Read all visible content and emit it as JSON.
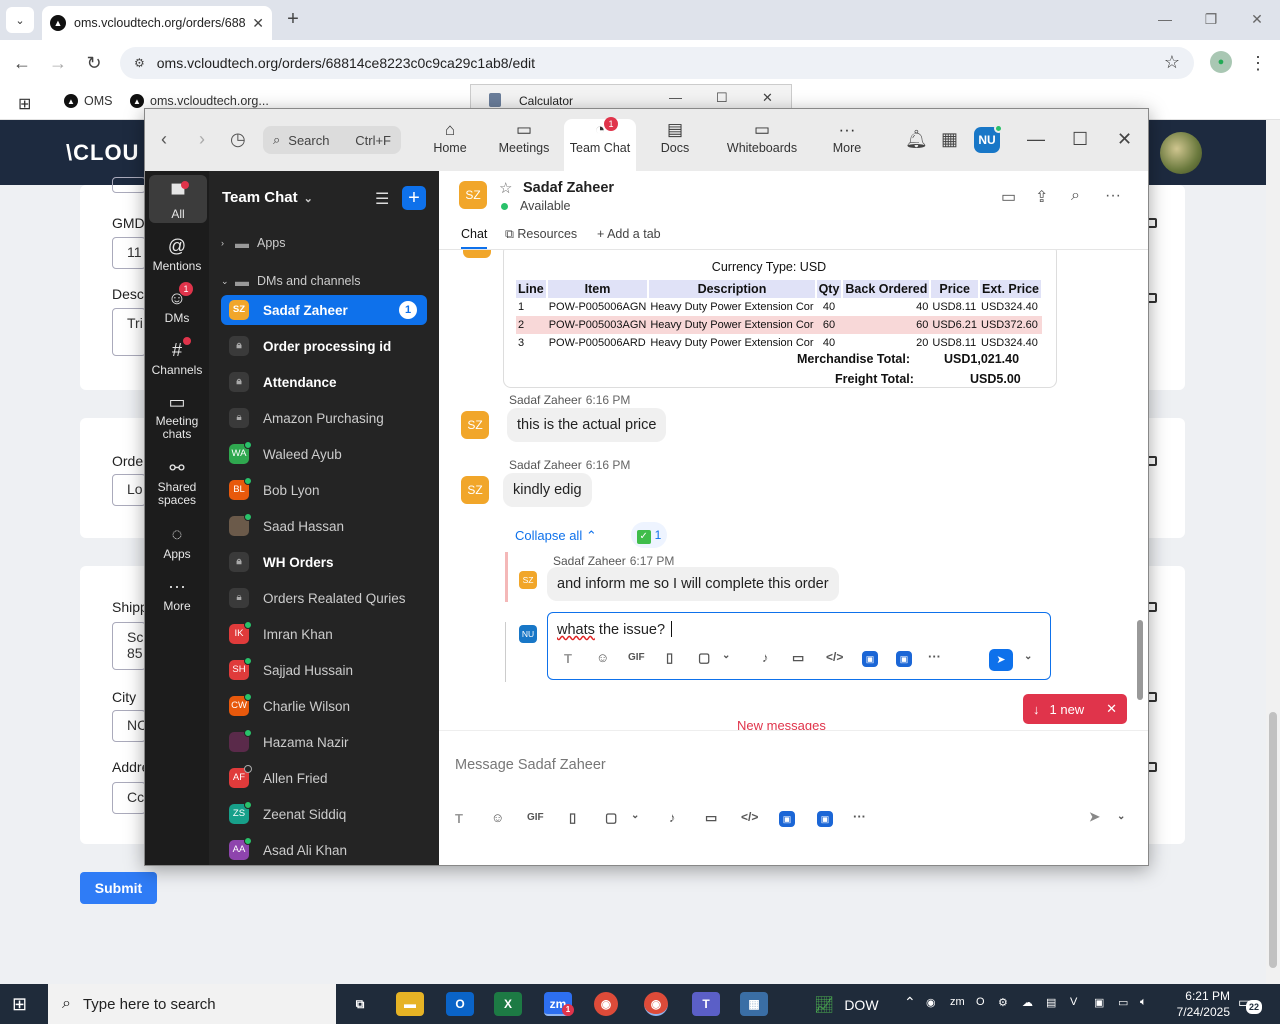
{
  "browser": {
    "tab_title": "oms.vcloudtech.org/orders/688",
    "url": "oms.vcloudtech.org/orders/68814ce8223c0c9ca29c1ab8/edit",
    "bookmarks": [
      "OMS",
      "oms.vcloudtech.org..."
    ]
  },
  "calculator": {
    "title": "Calculator"
  },
  "page": {
    "logo": "\\CLOU",
    "fields": [
      {
        "label": "GMD",
        "value": "11"
      },
      {
        "label": "Descr",
        "value": "Tri"
      },
      {
        "label": "Orde",
        "value": "Lo"
      },
      {
        "label": "Shipp",
        "value": "Sc",
        "value2": "85"
      },
      {
        "label": "City",
        "value": "NC"
      },
      {
        "label": "Addre",
        "value": "Cc"
      }
    ],
    "submit_label": "Submit"
  },
  "zoom": {
    "search_label": "Search",
    "search_shortcut": "Ctrl+F",
    "nav_tabs": [
      {
        "label": "Home",
        "icon": "home-icon"
      },
      {
        "label": "Meetings",
        "icon": "video-icon"
      },
      {
        "label": "Team Chat",
        "icon": "chat-icon",
        "badge": "1"
      },
      {
        "label": "Docs",
        "icon": "docs-icon"
      },
      {
        "label": "Whiteboards",
        "icon": "whiteboard-icon"
      },
      {
        "label": "More",
        "icon": "more-icon"
      }
    ],
    "user_initials": "NU",
    "rail": [
      {
        "label": "All"
      },
      {
        "label": "Mentions"
      },
      {
        "label": "DMs",
        "badge": "1"
      },
      {
        "label": "Channels"
      },
      {
        "label": "Meeting chats"
      },
      {
        "label": "Shared spaces"
      },
      {
        "label": "Apps"
      },
      {
        "label": "More"
      }
    ],
    "sidebar": {
      "title": "Team Chat",
      "section_apps": "Apps",
      "section_dms": "DMs and channels",
      "items": [
        {
          "initials": "SZ",
          "name": "Sadaf Zaheer",
          "count": "1",
          "color": "#f1a62a"
        },
        {
          "name": "Order processing id"
        },
        {
          "name": "Attendance"
        },
        {
          "name": "Amazon Purchasing"
        },
        {
          "initials": "WA",
          "name": "Waleed Ayub",
          "color": "#2fa84f"
        },
        {
          "initials": "BL",
          "name": "Bob Lyon",
          "color": "#e8590c"
        },
        {
          "name": "Saad Hassan",
          "color": "#6b5a4a"
        },
        {
          "name": "WH Orders"
        },
        {
          "name": "Orders Realated Quries"
        },
        {
          "initials": "IK",
          "name": "Imran Khan",
          "color": "#e03b3b"
        },
        {
          "initials": "SH",
          "name": "Sajjad Hussain",
          "color": "#e03b3b"
        },
        {
          "initials": "CW",
          "name": "Charlie Wilson",
          "color": "#e8590c"
        },
        {
          "name": "Hazama Nazir",
          "color": "#5a2a4a"
        },
        {
          "initials": "AF",
          "name": "Allen Fried",
          "color": "#e03b3b"
        },
        {
          "initials": "ZS",
          "name": "Zeenat Siddiq",
          "color": "#17a08a"
        },
        {
          "initials": "AA",
          "name": "Asad Ali Khan",
          "color": "#8e44ad"
        }
      ]
    },
    "chat": {
      "contact_initials": "SZ",
      "contact_name": "Sadaf Zaheer",
      "status": "Available",
      "tabs": [
        "Chat",
        "Resources",
        "Add a tab"
      ],
      "invoice": {
        "currency": "Currency Type: USD",
        "headers": [
          "Line",
          "Item",
          "Description",
          "Qty",
          "Back Ordered",
          "Price",
          "Ext. Price"
        ],
        "rows": [
          [
            "1",
            "POW-P005006AGN",
            "Heavy Duty Power Extension Cor",
            "40",
            "40",
            "USD8.11",
            "USD324.40"
          ],
          [
            "2",
            "POW-P005003AGN",
            "Heavy Duty Power Extension Cor",
            "60",
            "60",
            "USD6.21",
            "USD372.60"
          ],
          [
            "3",
            "POW-P005006ARD",
            "Heavy Duty Power Extension Cor",
            "40",
            "20",
            "USD8.11",
            "USD324.40"
          ]
        ],
        "merch_label": "Merchandise Total:",
        "merch_value": "USD1,021.40",
        "freight_label": "Freight Total:",
        "freight_value": "USD5.00"
      },
      "messages": [
        {
          "sender": "Sadaf Zaheer",
          "time": "6:16 PM",
          "text": "this is the actual price"
        },
        {
          "sender": "Sadaf Zaheer",
          "time": "6:16 PM",
          "text": "kindly edig"
        }
      ],
      "collapse_label": "Collapse all",
      "reaction_count": "1",
      "thread_reply": {
        "initials": "SZ",
        "sender": "Sadaf Zaheer",
        "time": "6:17 PM",
        "text": "and inform me so I will complete this order"
      },
      "draft": {
        "initials": "NU",
        "word1": "whats",
        "rest": " the issue? "
      },
      "new_messages_label": "New messages",
      "new_pill": "1 new",
      "composer_placeholder": "Message Sadaf Zaheer"
    }
  },
  "taskbar": {
    "search_placeholder": "Type here to search",
    "stock": "DOW",
    "time": "6:21 PM",
    "date": "7/24/2025",
    "notifications": "22",
    "zoom_badge": "1"
  }
}
